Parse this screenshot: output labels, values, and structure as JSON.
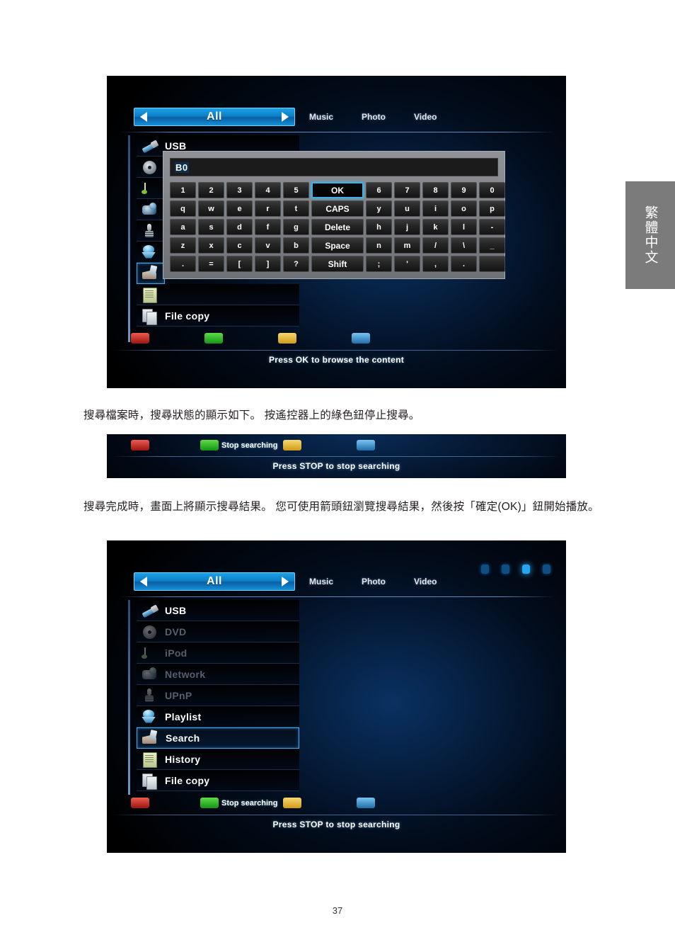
{
  "document": {
    "page_number": "37",
    "language_tab": "繁體中文",
    "paragraphs": {
      "p1": "搜尋檔案時，搜尋狀態的顯示如下。 按遙控器上的綠色鈕停止搜尋。",
      "p2": "搜尋完成時，畫面上將顯示搜尋結果。 您可使用箭頭鈕瀏覽搜尋結果，然後按「確定(OK)」鈕開始播放。"
    }
  },
  "colors": {
    "accent_blue": "#1aa2e8",
    "highlight_border": "#3fa9e8",
    "red": "#ef5a52",
    "green": "#5fdc4a",
    "yellow": "#f7d873",
    "blue": "#79c4f2"
  },
  "screen1": {
    "nav": {
      "prev_arrow": "arrow-left-icon",
      "selected_filter": "All",
      "next_arrow": "arrow-right-icon",
      "tabs": [
        "Music",
        "Photo",
        "Video"
      ]
    },
    "sidebar": [
      {
        "label": "USB",
        "icon": "usb-icon",
        "state": "normal"
      }
    ],
    "file_copy_label": "File copy",
    "file_copy_icon": "copy-icon",
    "keyboard": {
      "input_value": "B0",
      "rows": [
        [
          "1",
          "2",
          "3",
          "4",
          "5",
          "OK",
          "6",
          "7",
          "8",
          "9",
          "0"
        ],
        [
          "q",
          "w",
          "e",
          "r",
          "t",
          "CAPS",
          "y",
          "u",
          "i",
          "o",
          "p"
        ],
        [
          "a",
          "s",
          "d",
          "f",
          "g",
          "Delete",
          "h",
          "j",
          "k",
          "l",
          "-"
        ],
        [
          "z",
          "x",
          "c",
          "v",
          "b",
          "Space",
          "n",
          "m",
          "/",
          "\\",
          "_"
        ],
        [
          ".",
          "=",
          "[",
          "]",
          "?",
          "Shift",
          ";",
          "'",
          ",",
          ".",
          ""
        ]
      ],
      "function_keys": [
        "OK",
        "CAPS",
        "Delete",
        "Space",
        "Shift"
      ],
      "focused_key": "OK"
    },
    "bottom_bar": {
      "buttons": [
        {
          "color": "red",
          "label": ""
        },
        {
          "color": "green",
          "label": ""
        },
        {
          "color": "yellow",
          "label": ""
        },
        {
          "color": "blue",
          "label": ""
        }
      ],
      "hint": "Press OK to browse the content"
    }
  },
  "screen2": {
    "bottom_bar": {
      "buttons": [
        {
          "color": "red",
          "label": ""
        },
        {
          "color": "green",
          "label": "Stop searching"
        },
        {
          "color": "yellow",
          "label": ""
        },
        {
          "color": "blue",
          "label": ""
        }
      ],
      "hint": "Press STOP to stop searching"
    }
  },
  "screen3": {
    "nav": {
      "prev_arrow": "arrow-left-icon",
      "selected_filter": "All",
      "next_arrow": "arrow-right-icon",
      "tabs": [
        "Music",
        "Photo",
        "Video"
      ]
    },
    "page_dots": {
      "count": 4,
      "active_index": 2
    },
    "sidebar": [
      {
        "label": "USB",
        "icon": "usb-icon",
        "state": "normal"
      },
      {
        "label": "DVD",
        "icon": "dvd-icon",
        "state": "disabled"
      },
      {
        "label": "iPod",
        "icon": "ipod-icon",
        "state": "disabled"
      },
      {
        "label": "Network",
        "icon": "network-icon",
        "state": "disabled"
      },
      {
        "label": "UPnP",
        "icon": "upnp-icon",
        "state": "disabled"
      },
      {
        "label": "Playlist",
        "icon": "playlist-icon",
        "state": "normal"
      },
      {
        "label": "Search",
        "icon": "search-icon",
        "state": "selected"
      },
      {
        "label": "History",
        "icon": "history-icon",
        "state": "normal"
      },
      {
        "label": "File copy",
        "icon": "copy-icon",
        "state": "normal"
      }
    ],
    "bottom_bar": {
      "buttons": [
        {
          "color": "red",
          "label": ""
        },
        {
          "color": "green",
          "label": "Stop searching"
        },
        {
          "color": "yellow",
          "label": ""
        },
        {
          "color": "blue",
          "label": ""
        }
      ],
      "hint": "Press STOP to stop searching"
    }
  }
}
